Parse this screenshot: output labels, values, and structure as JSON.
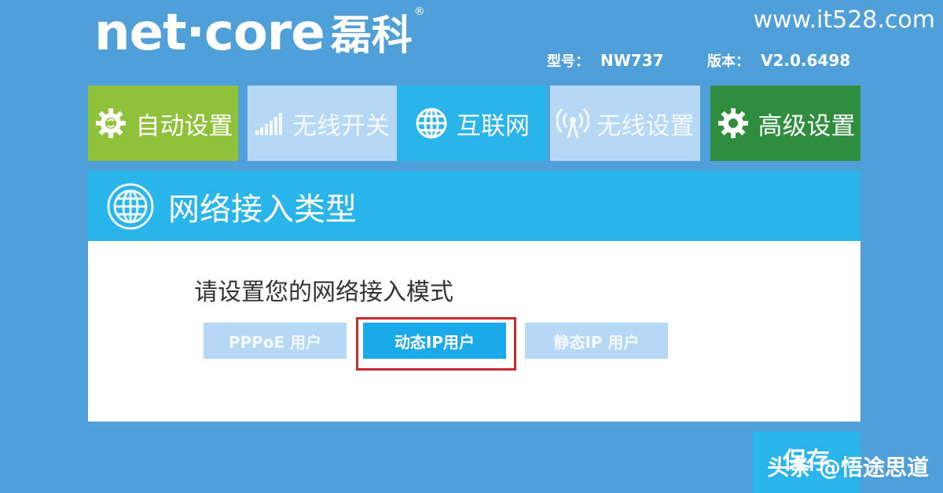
{
  "header": {
    "logo_en": "net·core",
    "logo_cn": "磊科",
    "logo_reg": "®",
    "site_url": "www.it528.com",
    "model_label": "型号：",
    "model_value": "NW737",
    "version_label": "版本：",
    "version_value": "V2.0.6498"
  },
  "tabs": [
    {
      "label": "自动设置",
      "icon": "gear-icon"
    },
    {
      "label": "无线开关",
      "icon": "signal-bars-icon"
    },
    {
      "label": "互联网",
      "icon": "globe-icon"
    },
    {
      "label": "无线设置",
      "icon": "antenna-icon"
    },
    {
      "label": "高级设置",
      "icon": "gear-icon"
    }
  ],
  "section": {
    "title": "网络接入类型",
    "icon": "globe-icon"
  },
  "panel": {
    "prompt": "请设置您的网络接入模式",
    "options": [
      {
        "label": "PPPoE 用户",
        "selected": false
      },
      {
        "label": "动态IP用户",
        "selected": true
      },
      {
        "label": "静态IP 用户",
        "selected": false
      }
    ]
  },
  "footer": {
    "save_label": "保存",
    "watermark": "头条 @悟途思道"
  },
  "colors": {
    "background": "#4f9fd8",
    "accent_cyan": "#29b5ea",
    "auto_green": "#8fc23a",
    "advanced_green": "#2f8e3d",
    "disabled_blue": "#b6d8f4",
    "highlight_red": "#c62a2a"
  }
}
